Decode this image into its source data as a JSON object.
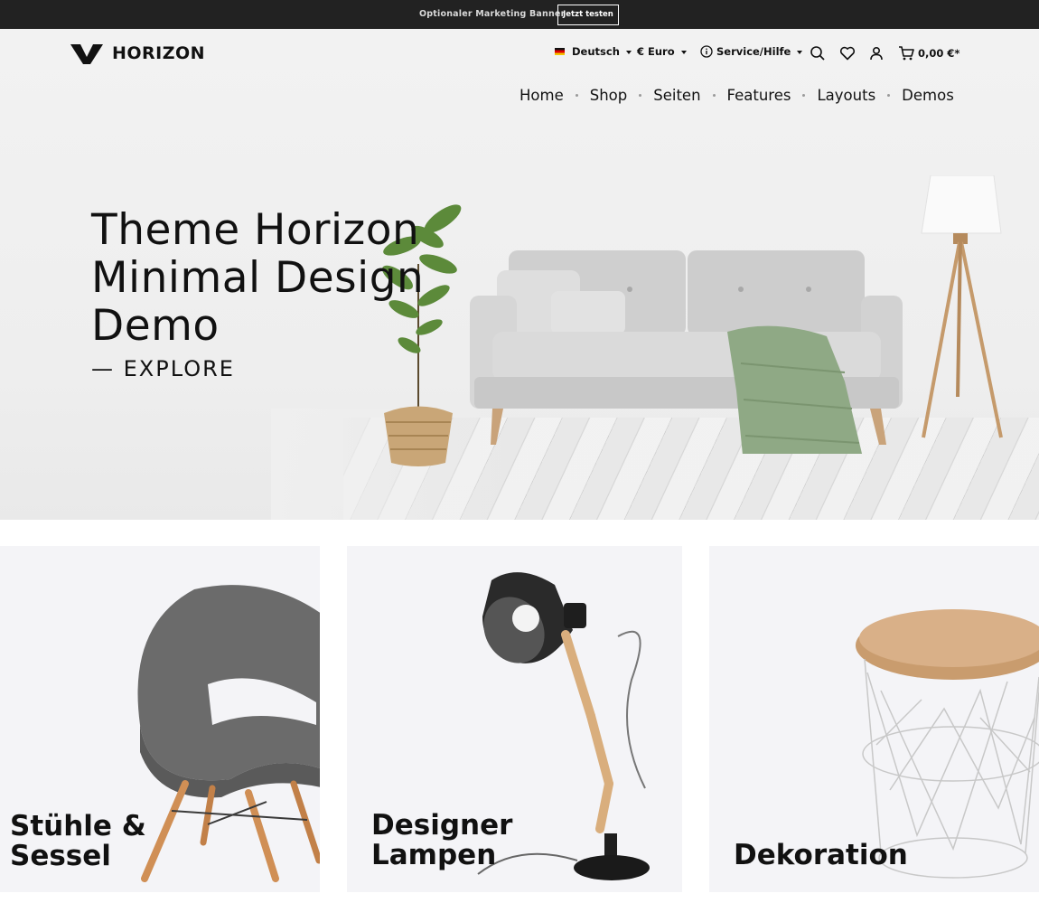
{
  "banner": {
    "text": "Optionaler Marketing Banner",
    "button_label": "Jetzt testen"
  },
  "header": {
    "brand": "HORIZON",
    "language": "Deutsch",
    "currency": "€ Euro",
    "service": "Service/Hilfe",
    "cart_total": "0,00 €*",
    "icons": [
      "search-icon",
      "heart-icon",
      "user-icon",
      "cart-icon",
      "info-icon",
      "flag-de-icon"
    ]
  },
  "nav": {
    "items": [
      {
        "label": "Home"
      },
      {
        "label": "Shop"
      },
      {
        "label": "Seiten"
      },
      {
        "label": "Features"
      },
      {
        "label": "Layouts"
      },
      {
        "label": "Demos"
      }
    ]
  },
  "hero": {
    "line1": "Theme Horizon",
    "line2": "Minimal Design",
    "line3": "Demo",
    "cta": "— EXPLORE"
  },
  "categories": [
    {
      "line1": "Stühle &",
      "line2": "Sessel"
    },
    {
      "line1": "Designer",
      "line2": "Lampen"
    },
    {
      "line1": "",
      "line2": "Dekoration"
    }
  ],
  "colors": {
    "banner_bg": "#222222",
    "text": "#111111",
    "tile_bg": "#f4f4f7",
    "throw_green": "#8fa985",
    "wood": "#c9a37a"
  }
}
